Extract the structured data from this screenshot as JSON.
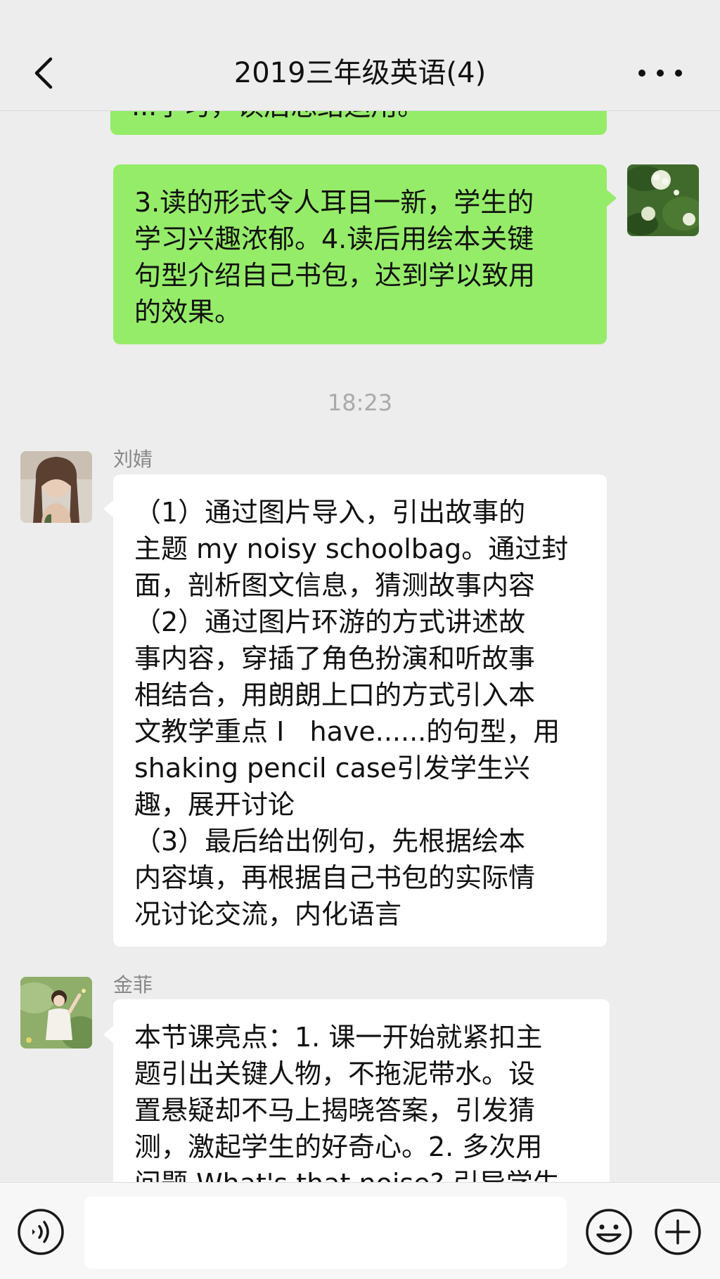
{
  "header": {
    "title": "2019三年级英语(4)"
  },
  "messages": {
    "partial_text": "...学习，读后总结运用。",
    "green_1": [
      "3.读的形式令人耳目一新，学生的",
      "学习兴趣浓郁。4.读后用绘本关键",
      "句型介绍自己书包，达到学以致用",
      "的效果。"
    ],
    "time": "18:23",
    "sender_1": "刘婧",
    "white_1": [
      "（1）通过图片导入，引出故事的",
      "主题 my noisy schoolbag。通过封",
      "面，剖析图文信息，猜测故事内容",
      "（2）通过图片环游的方式讲述故",
      "事内容，穿插了角色扮演和听故事",
      "相结合，用朗朗上口的方式引入本",
      "文教学重点 I   have......的句型，用",
      "shaking pencil case引发学生兴",
      "趣，展开讨论",
      "（3）最后给出例句，先根据绘本",
      "内容填，再根据自己书包的实际情",
      "况讨论交流，内化语言"
    ],
    "sender_2": "金菲",
    "white_2": [
      "本节课亮点：1. 课一开始就紧扣主",
      "题引出关键人物，不拖泥带水。设",
      "置悬疑却不马上揭晓答案，引发猜",
      "测，激起学生的好奇心。2. 多次用",
      "问题 What's that noise? 引导学生"
    ]
  },
  "icons": {
    "back": "chevron-left-icon",
    "more": "more-dots-icon",
    "voice": "voice-icon",
    "emoji": "emoji-icon",
    "plus": "plus-icon"
  },
  "colors": {
    "background": "#ededed",
    "self_bubble": "#95ec69",
    "other_bubble": "#ffffff"
  }
}
